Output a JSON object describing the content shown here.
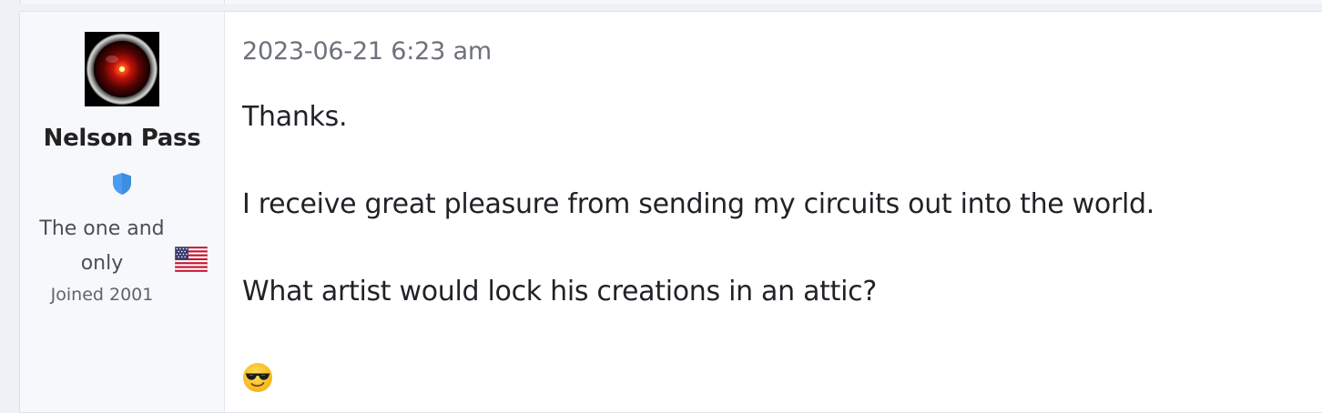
{
  "post": {
    "author": {
      "name": "Nelson Pass",
      "title": "The one and only",
      "joined": "Joined 2001",
      "avatar_icon": "hal-9000-eye-icon",
      "badge_icon": "shield-icon",
      "badge_color": "#4a9cf0",
      "country_icon": "us-flag-icon"
    },
    "timestamp": "2023-06-21 6:23 am",
    "paragraphs": [
      "Thanks.",
      "I receive great pleasure from sending my circuits out into the world.",
      "What artist would lock his creations in an attic?"
    ],
    "emoji_icon": "smiling-face-with-sunglasses-icon"
  }
}
